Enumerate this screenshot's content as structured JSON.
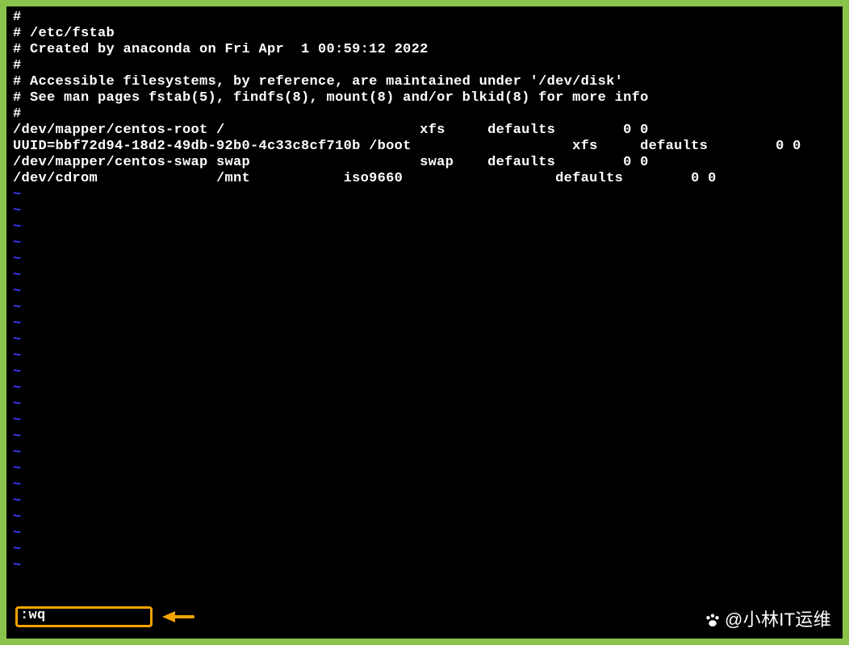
{
  "file": {
    "lines": [
      "#",
      "# /etc/fstab",
      "# Created by anaconda on Fri Apr  1 00:59:12 2022",
      "#",
      "# Accessible filesystems, by reference, are maintained under '/dev/disk'",
      "# See man pages fstab(5), findfs(8), mount(8) and/or blkid(8) for more info",
      "#",
      "/dev/mapper/centos-root /                       xfs     defaults        0 0",
      "UUID=bbf72d94-18d2-49db-92b0-4c33c8cf710b /boot                   xfs     defaults        0 0",
      "/dev/mapper/centos-swap swap                    swap    defaults        0 0",
      "/dev/cdrom              /mnt           iso9660                  defaults        0 0"
    ]
  },
  "tilde": "~",
  "tilde_count": 24,
  "command": ":wq",
  "watermark": {
    "handle": "@小林IT运维"
  }
}
